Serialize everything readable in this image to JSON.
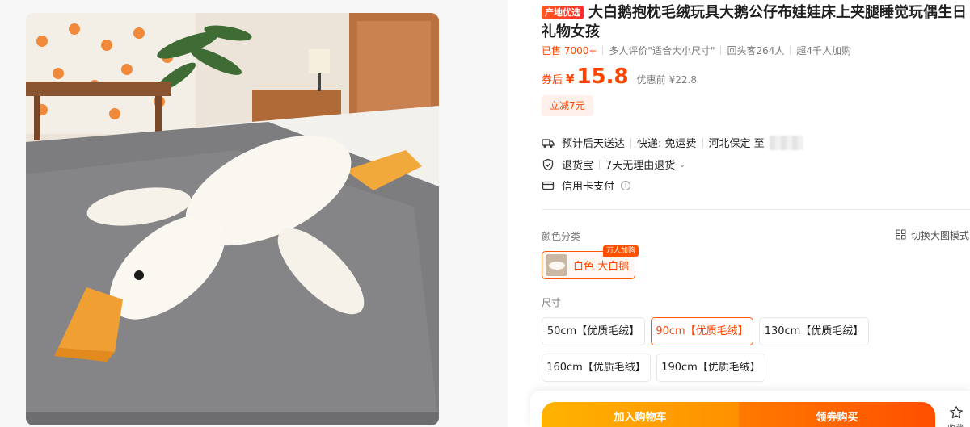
{
  "product": {
    "badge": "产地优选",
    "title": "大白鹅抱枕毛绒玩具大鹅公仔布娃娃床上夹腿睡觉玩偶生日礼物女孩",
    "image_icon": "white-goose-plush-photo"
  },
  "stats": {
    "sold": "已售 7000+",
    "review": "多人评价\"适合大小尺寸\"",
    "repeat": "回头客264人",
    "cart": "超4千人加购"
  },
  "price": {
    "label": "券后",
    "currency": "¥",
    "value": "15.8",
    "original_label": "优惠前",
    "original_value": "¥22.8"
  },
  "coupon": {
    "label": "立减7元"
  },
  "delivery": {
    "eta": "预计后天送达",
    "shipping": "快递: 免运费",
    "from": "河北保定 至"
  },
  "returns": {
    "label": "退货宝",
    "policy": "7天无理由退货"
  },
  "payment": {
    "label": "信用卡支付"
  },
  "color_section": {
    "label": "颜色分类",
    "switch_label": "切换大图模式",
    "option": "白色 大白鹅",
    "hot_tag": "万人加购"
  },
  "size_section": {
    "label": "尺寸",
    "options": [
      "50cm【优质毛绒】",
      "90cm【优质毛绒】",
      "130cm【优质毛绒】",
      "160cm【优质毛绒】",
      "190cm【优质毛绒】"
    ],
    "selected": "90cm【优质毛绒】"
  },
  "actions": {
    "add_to_cart": "加入购物车",
    "buy_now": "领券购买",
    "favorite": "收藏"
  },
  "colors": {
    "accent": "#ff4400",
    "cart_button": "#ffa800",
    "buy_button": "#ff5a00"
  }
}
